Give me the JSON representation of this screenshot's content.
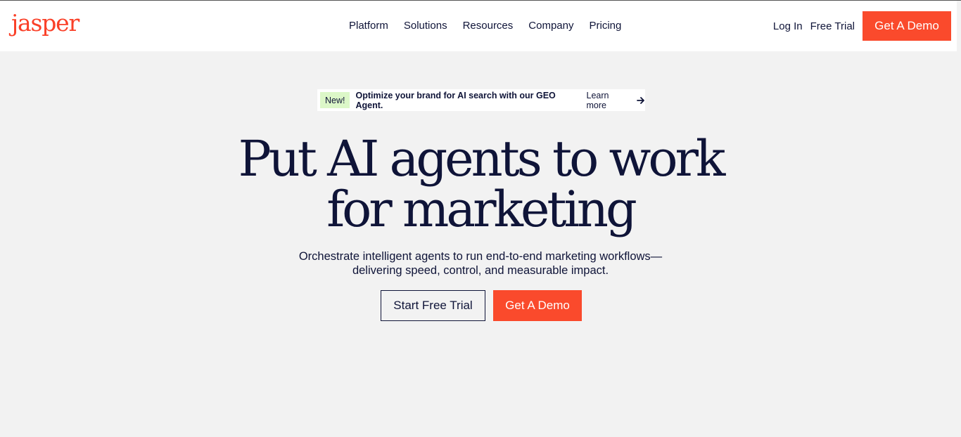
{
  "brand": {
    "logo_text": "jasper",
    "accent_color": "#fa4a2c"
  },
  "nav": {
    "items": [
      {
        "label": "Platform"
      },
      {
        "label": "Solutions"
      },
      {
        "label": "Resources"
      },
      {
        "label": "Company"
      },
      {
        "label": "Pricing"
      }
    ],
    "login_label": "Log In",
    "free_trial_label": "Free Trial",
    "demo_label": "Get A Demo"
  },
  "announcement": {
    "badge": "New!",
    "text": "Optimize your brand for AI search with our GEO Agent.",
    "link_label": "Learn more",
    "icon": "arrow-right-icon"
  },
  "hero": {
    "title_line1": "Put AI agents to work",
    "title_line2": "for marketing",
    "subtitle_line1": "Orchestrate intelligent agents to run end-to-end marketing workflows—",
    "subtitle_line2": "delivering speed, control, and measurable impact.",
    "cta_trial_label": "Start Free Trial",
    "cta_demo_label": "Get A Demo"
  }
}
